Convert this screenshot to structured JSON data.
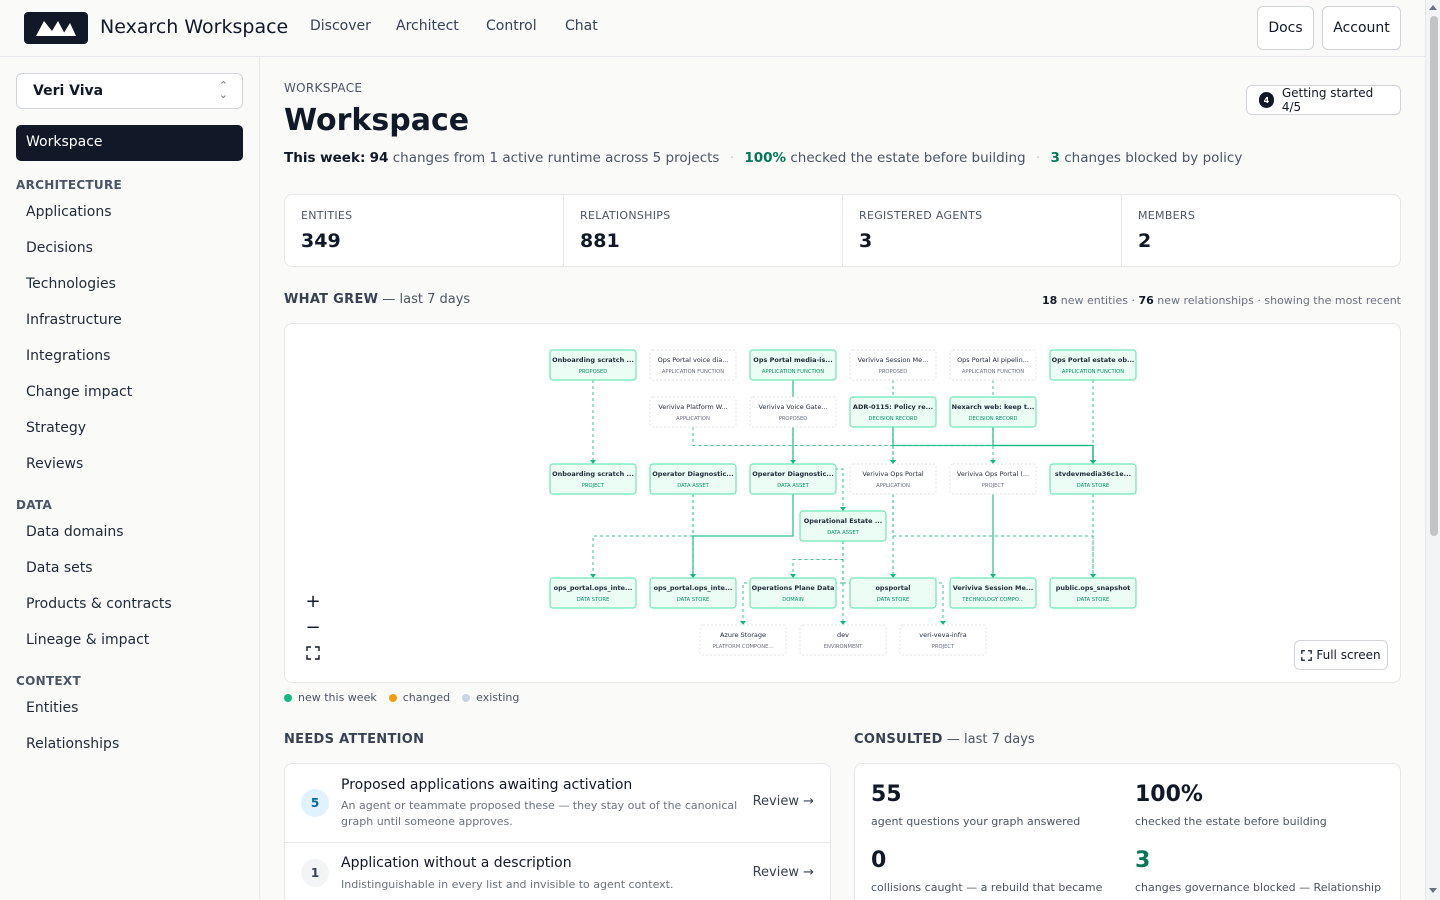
{
  "header": {
    "brand": "Nexarch Workspace",
    "nav": [
      "Discover",
      "Architect",
      "Control",
      "Chat"
    ],
    "docs_label": "Docs",
    "account_label": "Account"
  },
  "sidebar": {
    "workspace_selector": "Veri Viva",
    "active_item": "Workspace",
    "sections": [
      {
        "title": "ARCHITECTURE",
        "items": [
          "Applications",
          "Decisions",
          "Technologies",
          "Infrastructure",
          "Integrations",
          "Change impact",
          "Strategy",
          "Reviews"
        ]
      },
      {
        "title": "DATA",
        "items": [
          "Data domains",
          "Data sets",
          "Products & contracts",
          "Lineage & impact"
        ]
      },
      {
        "title": "CONTEXT",
        "items": [
          "Entities",
          "Relationships"
        ]
      }
    ]
  },
  "page": {
    "eyebrow": "WORKSPACE",
    "title": "Workspace",
    "getting_started": "Getting started 4/5",
    "getting_started_badge": "4",
    "summary": {
      "prefix": "This week:",
      "changes": "94",
      "changes_text": "changes from 1 active runtime across 5 projects",
      "checked": "100%",
      "checked_text": "checked the estate before building",
      "blocked": "3",
      "blocked_text": "changes blocked by policy"
    }
  },
  "stats": [
    {
      "label": "ENTITIES",
      "value": "349"
    },
    {
      "label": "RELATIONSHIPS",
      "value": "881"
    },
    {
      "label": "REGISTERED AGENTS",
      "value": "3"
    },
    {
      "label": "MEMBERS",
      "value": "2"
    }
  ],
  "what_grew": {
    "title": "WHAT GREW",
    "period": "— last 7 days",
    "new_entities": "18",
    "new_entities_text": "new entities ·",
    "new_relationships": "76",
    "new_relationships_text": "new relationships · showing the most recent",
    "fullscreen_label": "Full screen",
    "nodes": [
      {
        "title": "Onboarding scratch ...",
        "type": "PROPOSED",
        "status": "new"
      },
      {
        "title": "Ops Portal voice dia...",
        "type": "APPLICATION FUNCTION",
        "status": "existing"
      },
      {
        "title": "Ops Portal media-is...",
        "type": "APPLICATION FUNCTION",
        "status": "new"
      },
      {
        "title": "Veriviva Session Me...",
        "type": "PROPOSED",
        "status": "existing"
      },
      {
        "title": "Ops Portal AI pipelin...",
        "type": "APPLICATION FUNCTION",
        "status": "existing"
      },
      {
        "title": "Ops Portal estate ob...",
        "type": "APPLICATION FUNCTION",
        "status": "new"
      },
      {
        "title": "Veriviva Platform W...",
        "type": "APPLICATION",
        "status": "existing"
      },
      {
        "title": "Veriviva Voice Gate...",
        "type": "PROPOSED",
        "status": "existing"
      },
      {
        "title": "ADR-0115: Policy re...",
        "type": "DECISION RECORD",
        "status": "new"
      },
      {
        "title": "Nexarch web: keep t...",
        "type": "DECISION RECORD",
        "status": "new"
      },
      {
        "title": "Onboarding scratch ...",
        "type": "PROJECT",
        "status": "new"
      },
      {
        "title": "Operator Diagnostic...",
        "type": "DATA ASSET",
        "status": "new"
      },
      {
        "title": "Operator Diagnostic...",
        "type": "DATA ASSET",
        "status": "new"
      },
      {
        "title": "Veriviva Ops Portal",
        "type": "APPLICATION",
        "status": "existing"
      },
      {
        "title": "Veriviva Ops Portal (...",
        "type": "PROJECT",
        "status": "existing"
      },
      {
        "title": "stvdevmedia36c1e...",
        "type": "DATA STORE",
        "status": "new"
      },
      {
        "title": "Operational Estate ...",
        "type": "DATA ASSET",
        "status": "new"
      },
      {
        "title": "ops_portal.ops_inte...",
        "type": "DATA STORE",
        "status": "new"
      },
      {
        "title": "ops_portal.ops_inte...",
        "type": "DATA STORE",
        "status": "new"
      },
      {
        "title": "Operations Plane Data",
        "type": "DOMAIN",
        "status": "new"
      },
      {
        "title": "opsportal",
        "type": "DATA STORE",
        "status": "new"
      },
      {
        "title": "Veriviva Session Me...",
        "type": "TECHNOLOGY COMPO...",
        "status": "new"
      },
      {
        "title": "public.ops_snapshot",
        "type": "DATA STORE",
        "status": "new"
      },
      {
        "title": "Azure Storage",
        "type": "PLATFORM COMPONE...",
        "status": "existing"
      },
      {
        "title": "dev",
        "type": "ENVIRONMENT",
        "status": "existing"
      },
      {
        "title": "veri-veva-infra",
        "type": "PROJECT",
        "status": "existing"
      }
    ]
  },
  "legend": [
    {
      "label": "new this week",
      "color": "#10b981"
    },
    {
      "label": "changed",
      "color": "#f59e0b"
    },
    {
      "label": "existing",
      "color": "#cbd5e1"
    }
  ],
  "needs_attention": {
    "title": "NEEDS ATTENTION",
    "items": [
      {
        "count": "5",
        "title": "Proposed applications awaiting activation",
        "desc": "An agent or teammate proposed these — they stay out of the canonical graph until someone approves.",
        "action": "Review →"
      },
      {
        "count": "1",
        "title": "Application without a description",
        "desc": "Indistinguishable in every list and invisible to agent context.",
        "action": "Review →"
      }
    ]
  },
  "consulted": {
    "title": "CONSULTED",
    "period": "— last 7 days",
    "metrics": [
      {
        "value": "55",
        "label": "agent questions your graph answered"
      },
      {
        "value": "100%",
        "label": "checked the estate before building"
      },
      {
        "value": "0",
        "label": "collisions caught — a rebuild that became"
      },
      {
        "value": "3",
        "label": "changes governance blocked — Relationship"
      }
    ]
  },
  "colors": {
    "brand_dark": "#111827",
    "accent_green": "#047857",
    "node_new_fill": "#ecfdf5",
    "node_new_border": "#6ee7b7",
    "edge": "#10b981"
  }
}
